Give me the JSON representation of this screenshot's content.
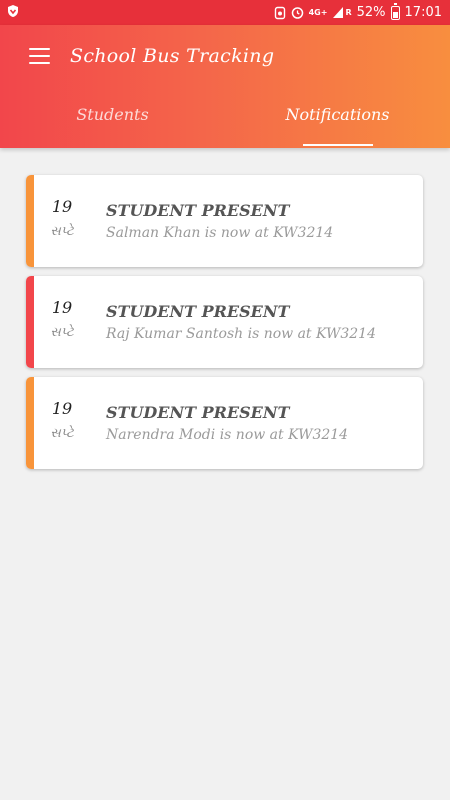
{
  "status_bar": {
    "network": "4G+",
    "signal_label": "R",
    "battery_percent": "52%",
    "time": "17:01"
  },
  "app_bar": {
    "title": "School Bus Tracking"
  },
  "tabs": [
    {
      "label": "Students",
      "active": false
    },
    {
      "label": "Notifications",
      "active": true
    }
  ],
  "notifications": [
    {
      "day": "19",
      "month": "સપ્ટે",
      "title": "STUDENT PRESENT",
      "message": "Salman Khan is now at KW3214",
      "accent_color": "#f8943a"
    },
    {
      "day": "19",
      "month": "સપ્ટે",
      "title": "STUDENT PRESENT",
      "message": "Raj Kumar Santosh is now at KW3214",
      "accent_color": "#f2464b"
    },
    {
      "day": "19",
      "month": "સપ્ટે",
      "title": "STUDENT PRESENT",
      "message": "Narendra Modi is now at KW3214",
      "accent_color": "#f8943a"
    }
  ],
  "colors": {
    "statusbar": "#e7303a",
    "gradient_start": "#f2464b",
    "gradient_end": "#f88e3f",
    "background": "#f1f1f1"
  }
}
